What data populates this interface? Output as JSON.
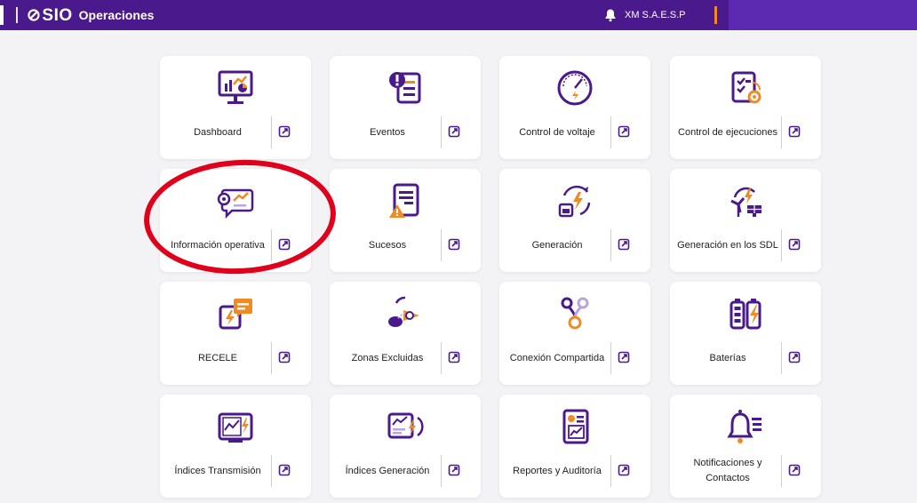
{
  "header": {
    "brand": "SIO",
    "brand_slash": "⊘",
    "section": "Operaciones",
    "user": "XM S.A.E.S.P"
  },
  "colors": {
    "primary": "#4a1a8c",
    "accent": "#f08a24",
    "highlight": "#e0001b"
  },
  "cards": [
    {
      "label": "Dashboard",
      "icon": "dashboard-monitor-icon"
    },
    {
      "label": "Eventos",
      "icon": "eventos-alert-icon"
    },
    {
      "label": "Control de voltaje",
      "icon": "voltage-gauge-icon"
    },
    {
      "label": "Control de ejecuciones",
      "icon": "checklist-gear-icon"
    },
    {
      "label": "Información operativa",
      "icon": "chat-chart-icon"
    },
    {
      "label": "Sucesos",
      "icon": "document-warning-icon"
    },
    {
      "label": "Generación",
      "icon": "calendar-bolt-icon"
    },
    {
      "label": "Generación en los SDL",
      "icon": "wind-solar-icon"
    },
    {
      "label": "RECELE",
      "icon": "bolt-message-icon"
    },
    {
      "label": "Zonas Excluidas",
      "icon": "zones-excluded-icon"
    },
    {
      "label": "Conexión Compartida",
      "icon": "shared-connection-icon"
    },
    {
      "label": "Baterías",
      "icon": "battery-icon"
    },
    {
      "label": "Índices Transmisión",
      "icon": "transmission-index-icon"
    },
    {
      "label": "Índices Generación",
      "icon": "generation-index-icon"
    },
    {
      "label": "Reportes y Auditoría",
      "icon": "report-chart-icon"
    },
    {
      "label": "Notificaciones y Contactos",
      "icon": "bell-list-icon"
    }
  ]
}
